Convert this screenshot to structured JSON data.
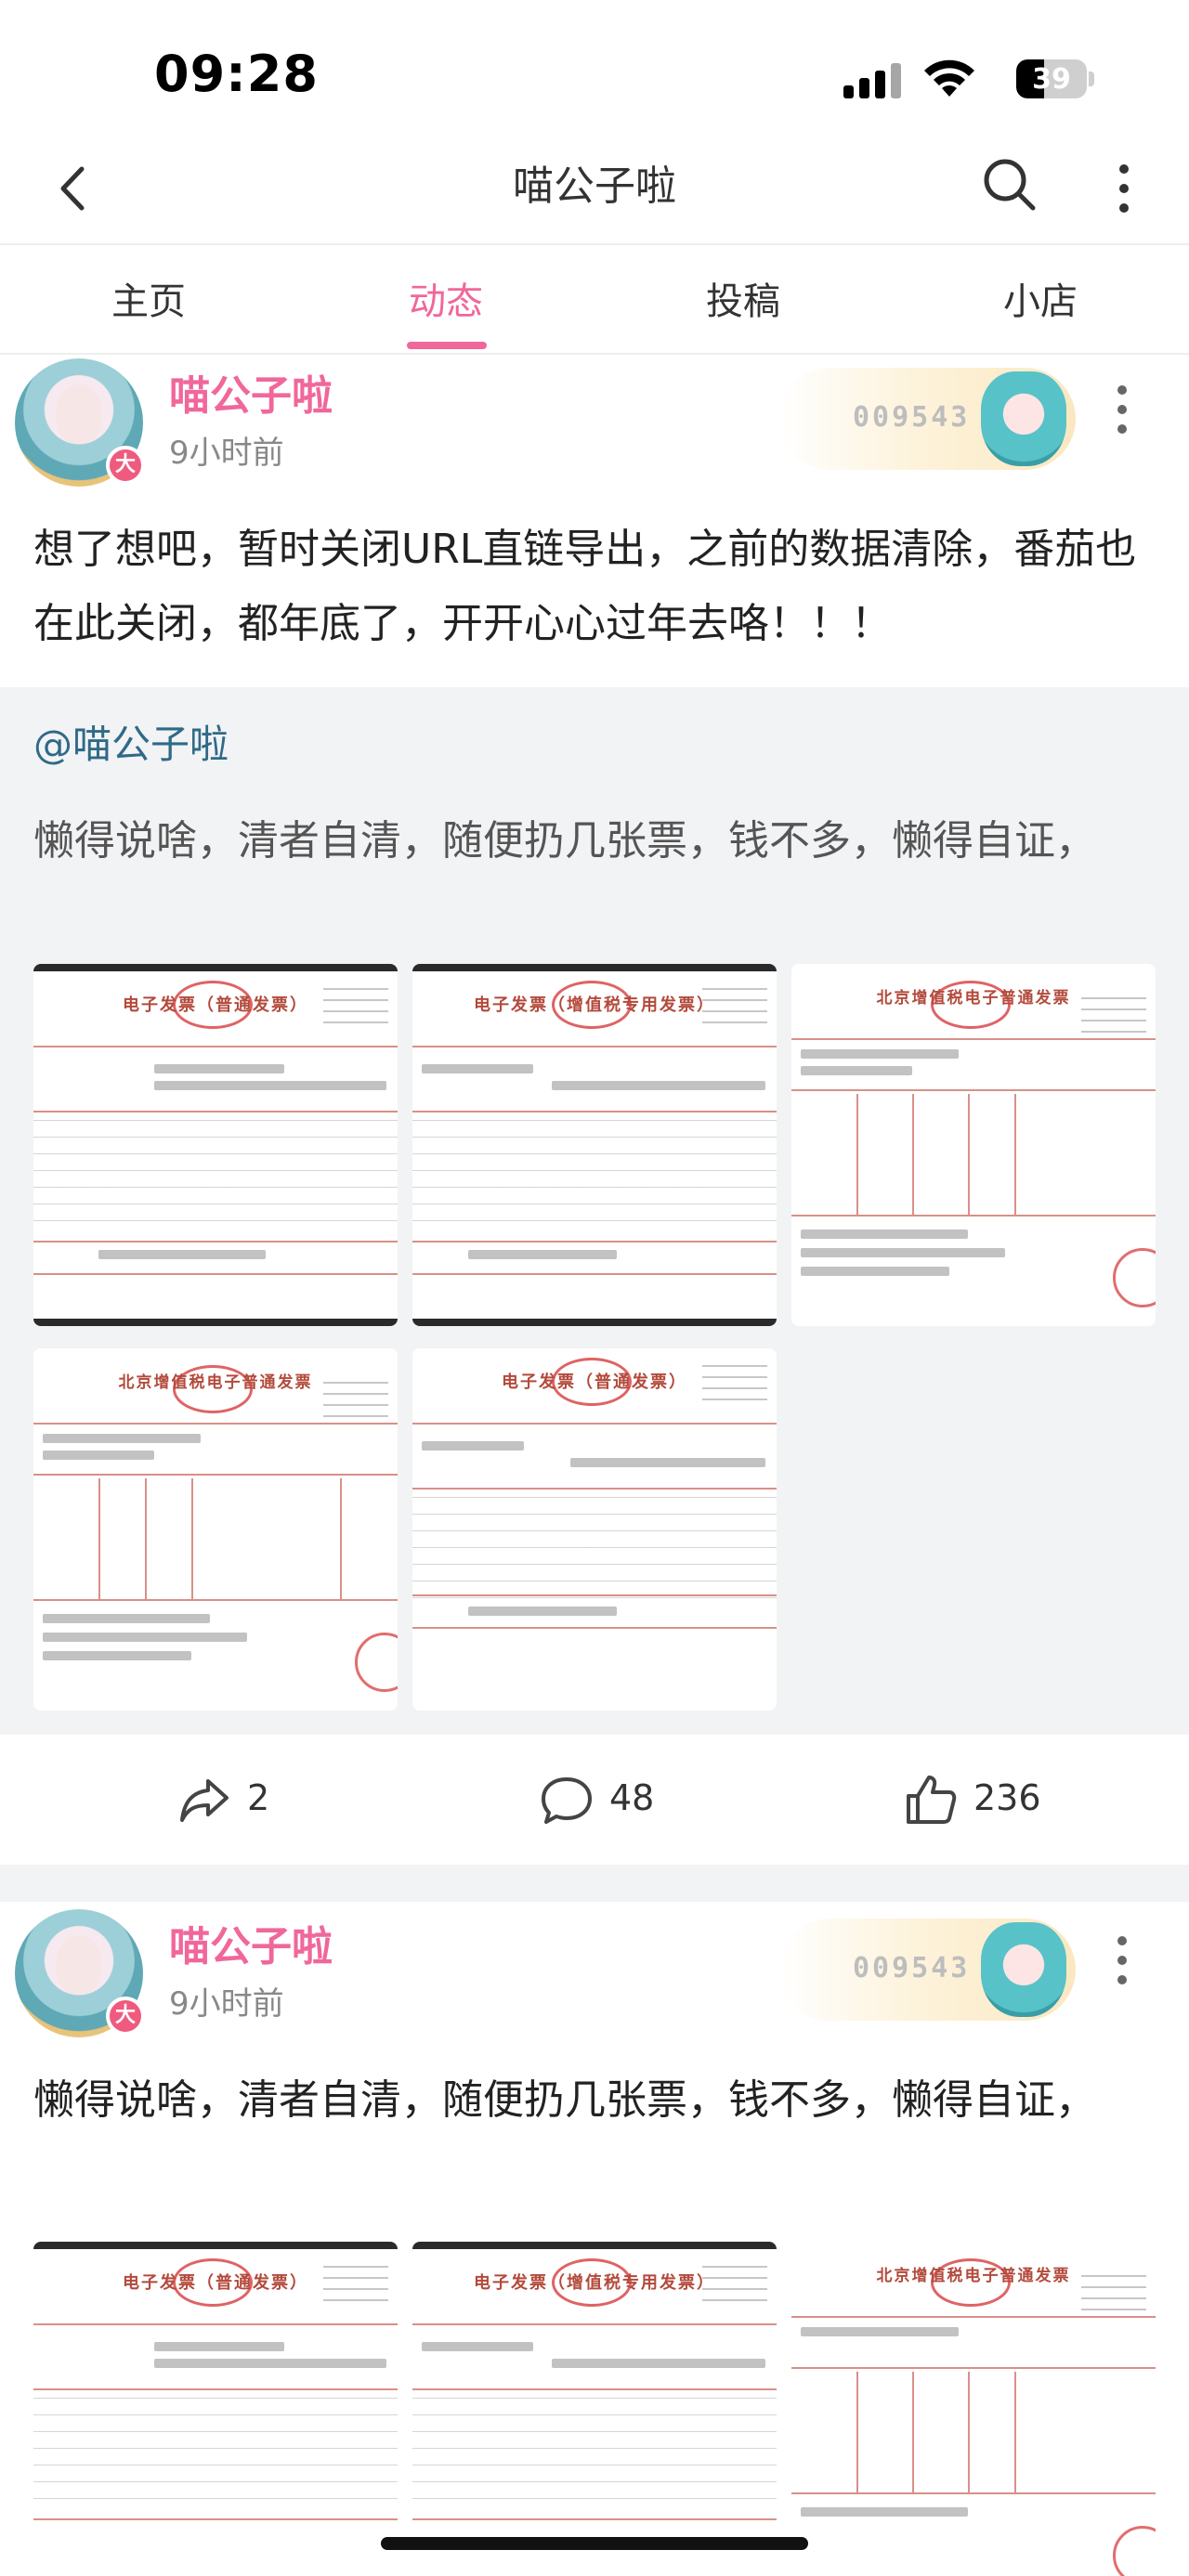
{
  "status_bar": {
    "time": "09:28",
    "battery": "39",
    "battery_level": 0.39
  },
  "nav": {
    "title": "喵公子啦"
  },
  "tabs": [
    {
      "label": "主页"
    },
    {
      "label": "动态"
    },
    {
      "label": "投稿"
    },
    {
      "label": "小店"
    }
  ],
  "active_tab": "动态",
  "posts": [
    {
      "author": "喵公子啦",
      "avatar_badge": "大",
      "time": "9小时前",
      "fan_badge_number": "009543",
      "text": "想了想吧，暂时关闭URL直链导出，之前的数据清除，番茄也在此关闭，都年底了，开开心心过年去咯！！！",
      "repost": {
        "mention": "@喵公子啦",
        "text": "懒得说啥，清者自清，随便扔几张票，钱不多，懒得自证，",
        "images": [
          {
            "title": "电子发票（普通发票）"
          },
          {
            "title": "电子发票（增值税专用发票）"
          },
          {
            "title": "北京增值税电子普通发票"
          },
          {
            "title": "北京增值税电子普通发票"
          },
          {
            "title": "电子发票（普通发票）"
          }
        ]
      },
      "stats": {
        "shares": "2",
        "comments": "48",
        "likes": "236"
      }
    },
    {
      "author": "喵公子啦",
      "avatar_badge": "大",
      "time": "9小时前",
      "fan_badge_number": "009543",
      "text": "懒得说啥，清者自清，随便扔几张票，钱不多，懒得自证，",
      "images": [
        {
          "title": "电子发票（普通发票）"
        },
        {
          "title": "电子发票（增值税专用发票）"
        },
        {
          "title": "北京增值税电子普通发票"
        }
      ]
    }
  ],
  "colors": {
    "accent": "#f0679b",
    "mention": "#2f6a87",
    "repost_bg": "#f2f3f5"
  },
  "icons": [
    "back-icon",
    "search-icon",
    "more-icon",
    "share-icon",
    "comment-icon",
    "like-icon"
  ]
}
